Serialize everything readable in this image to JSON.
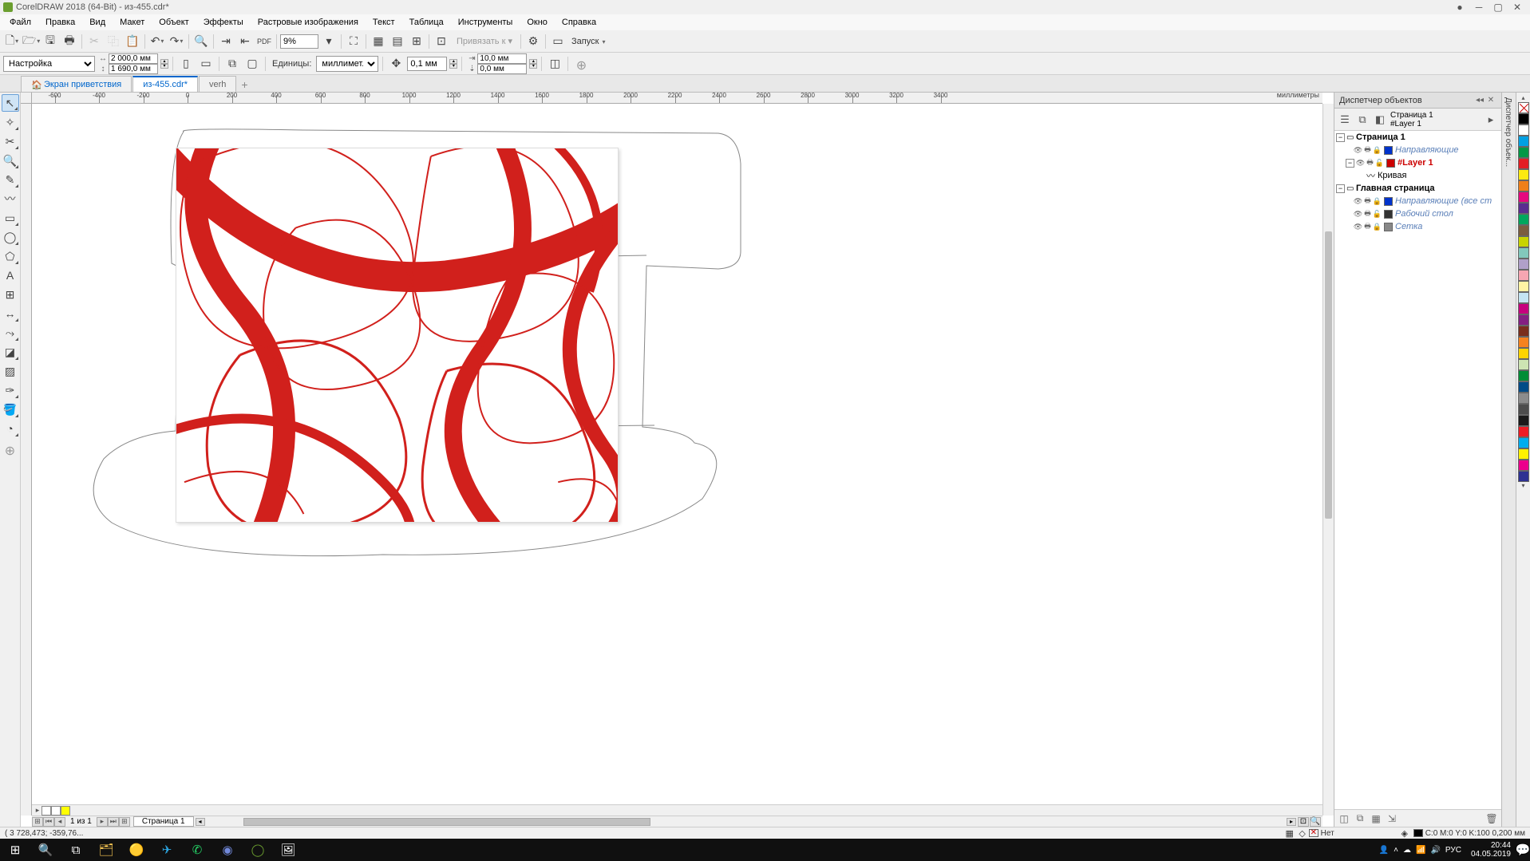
{
  "app": {
    "title": "CorelDRAW 2018 (64-Bit) - из-455.cdr*"
  },
  "menu": [
    "Файл",
    "Правка",
    "Вид",
    "Макет",
    "Объект",
    "Эффекты",
    "Растровые изображения",
    "Текст",
    "Таблица",
    "Инструменты",
    "Окно",
    "Справка"
  ],
  "toolbar1": {
    "zoom": "9%",
    "snap_label": "Привязать к ▾",
    "launch_label": "Запуск"
  },
  "propbar": {
    "preset": "Настройка",
    "width": "2 000,0 мм",
    "height": "1 690,0 мм",
    "units_label": "Единицы:",
    "units_value": "миллимет...",
    "nudge": "0,1 мм",
    "dupx": "10,0 мм",
    "dupy": "0,0 мм"
  },
  "tabs": {
    "welcome": "Экран приветствия",
    "doc1": "из-455.cdr*",
    "doc2": "verh"
  },
  "ruler_unit": "миллиметры",
  "page_nav": {
    "current": "1",
    "of_label": "из",
    "total": "1"
  },
  "page_tab": "Страница 1",
  "docker": {
    "title": "Диспетчер объектов",
    "page_info_line1": "Страница 1",
    "page_info_line2": "#Layer 1",
    "tree": {
      "page1": "Страница 1",
      "guides": "Направляющие",
      "layer1": "#Layer 1",
      "curve": "Кривая",
      "master": "Главная страница",
      "guides_all": "Направляющие (все ст",
      "desktop": "Рабочий стол",
      "grid": "Сетка"
    }
  },
  "docker_tab": "Диспетчер объек...",
  "status": {
    "coords": "( 3 728,473; -359,76...",
    "fill_none": "Нет",
    "outline": "C:0 M:0 Y:0 K:100 0,200 мм"
  },
  "tray": {
    "lang": "РУС",
    "time": "20:44",
    "date": "04.05.2019"
  },
  "palette": [
    "#000000",
    "#ffffff",
    "#00a0e3",
    "#009846",
    "#e31e24",
    "#fcea10",
    "#ef7f1a",
    "#e5097f",
    "#5b2d90",
    "#00a65d",
    "#7b5c3f",
    "#c9d300",
    "#82c8bc",
    "#b0a0c9",
    "#f6a6b2",
    "#fff3a4",
    "#c4e4f2",
    "#c6007e",
    "#841f82",
    "#7a2e1d",
    "#f5821f",
    "#ffd400",
    "#cde4b3",
    "#008d36",
    "#004b87",
    "#8c8c8c",
    "#4d4d4d",
    "#1a1a1a",
    "#ed1c24",
    "#00adef",
    "#fff200",
    "#ec008c",
    "#2e3192"
  ],
  "palette_bottom": [
    "#ffffff",
    "#ffff00"
  ],
  "hruler_ticks": [
    -600,
    -400,
    -200,
    0,
    200,
    400,
    600,
    800,
    1000,
    1200,
    1400,
    1600,
    1800,
    2000,
    2200,
    2400,
    2600,
    2800,
    3000,
    3200,
    3400
  ]
}
